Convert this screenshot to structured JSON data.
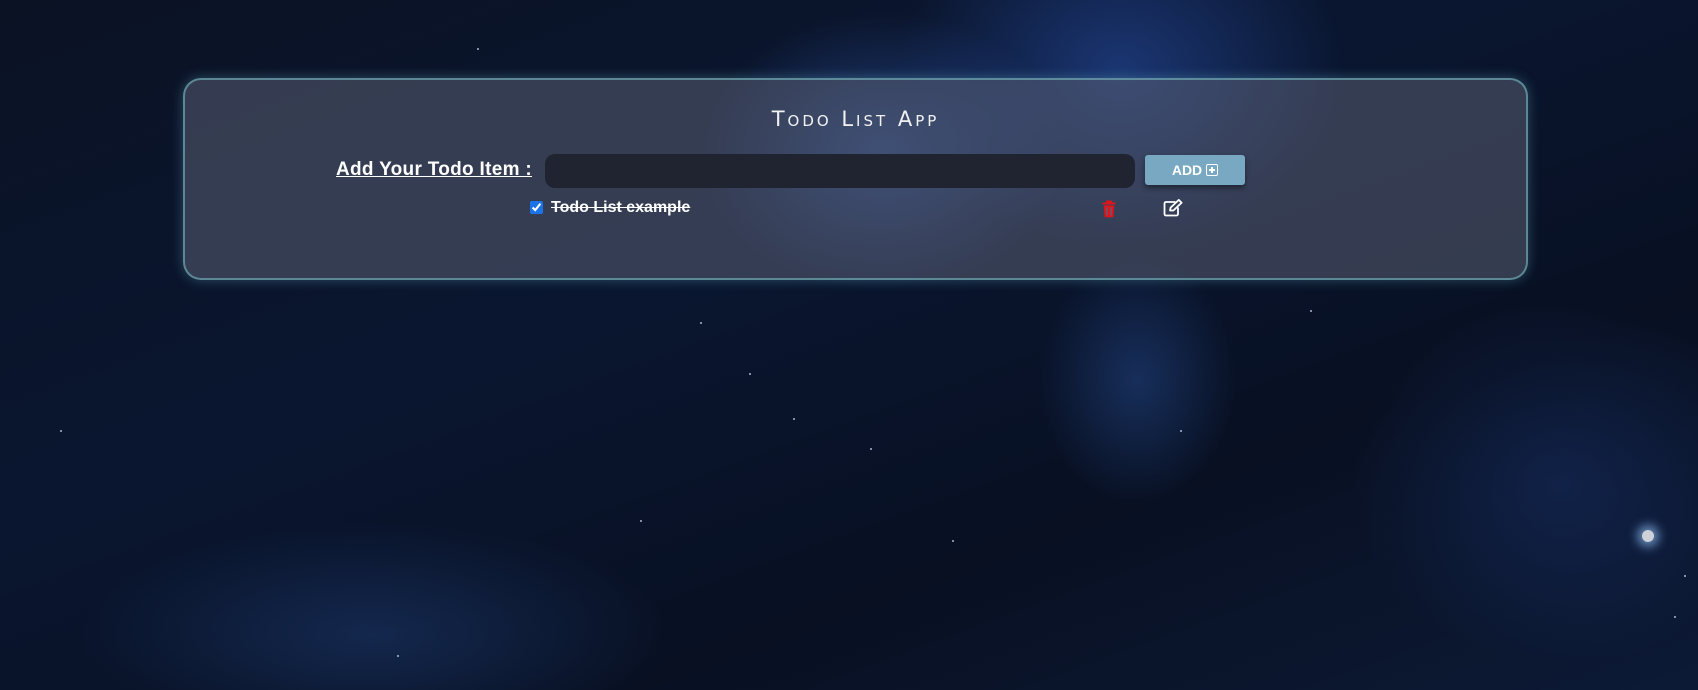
{
  "app": {
    "title": "Todo List App"
  },
  "form": {
    "label": "Add Your Todo Item :",
    "input_value": "",
    "input_placeholder": "",
    "add_button_label": "ADD",
    "add_button_icon": "plus-square-icon"
  },
  "todos": [
    {
      "text": "Todo List example",
      "checked": true,
      "delete_icon": "trash-icon",
      "edit_icon": "edit-icon"
    }
  ],
  "colors": {
    "card_border": "#6eaab4",
    "add_button": "#79a9c2",
    "delete_icon": "#e0151b",
    "checkbox": "#1a73e8",
    "input_bg": "#1f2430"
  }
}
